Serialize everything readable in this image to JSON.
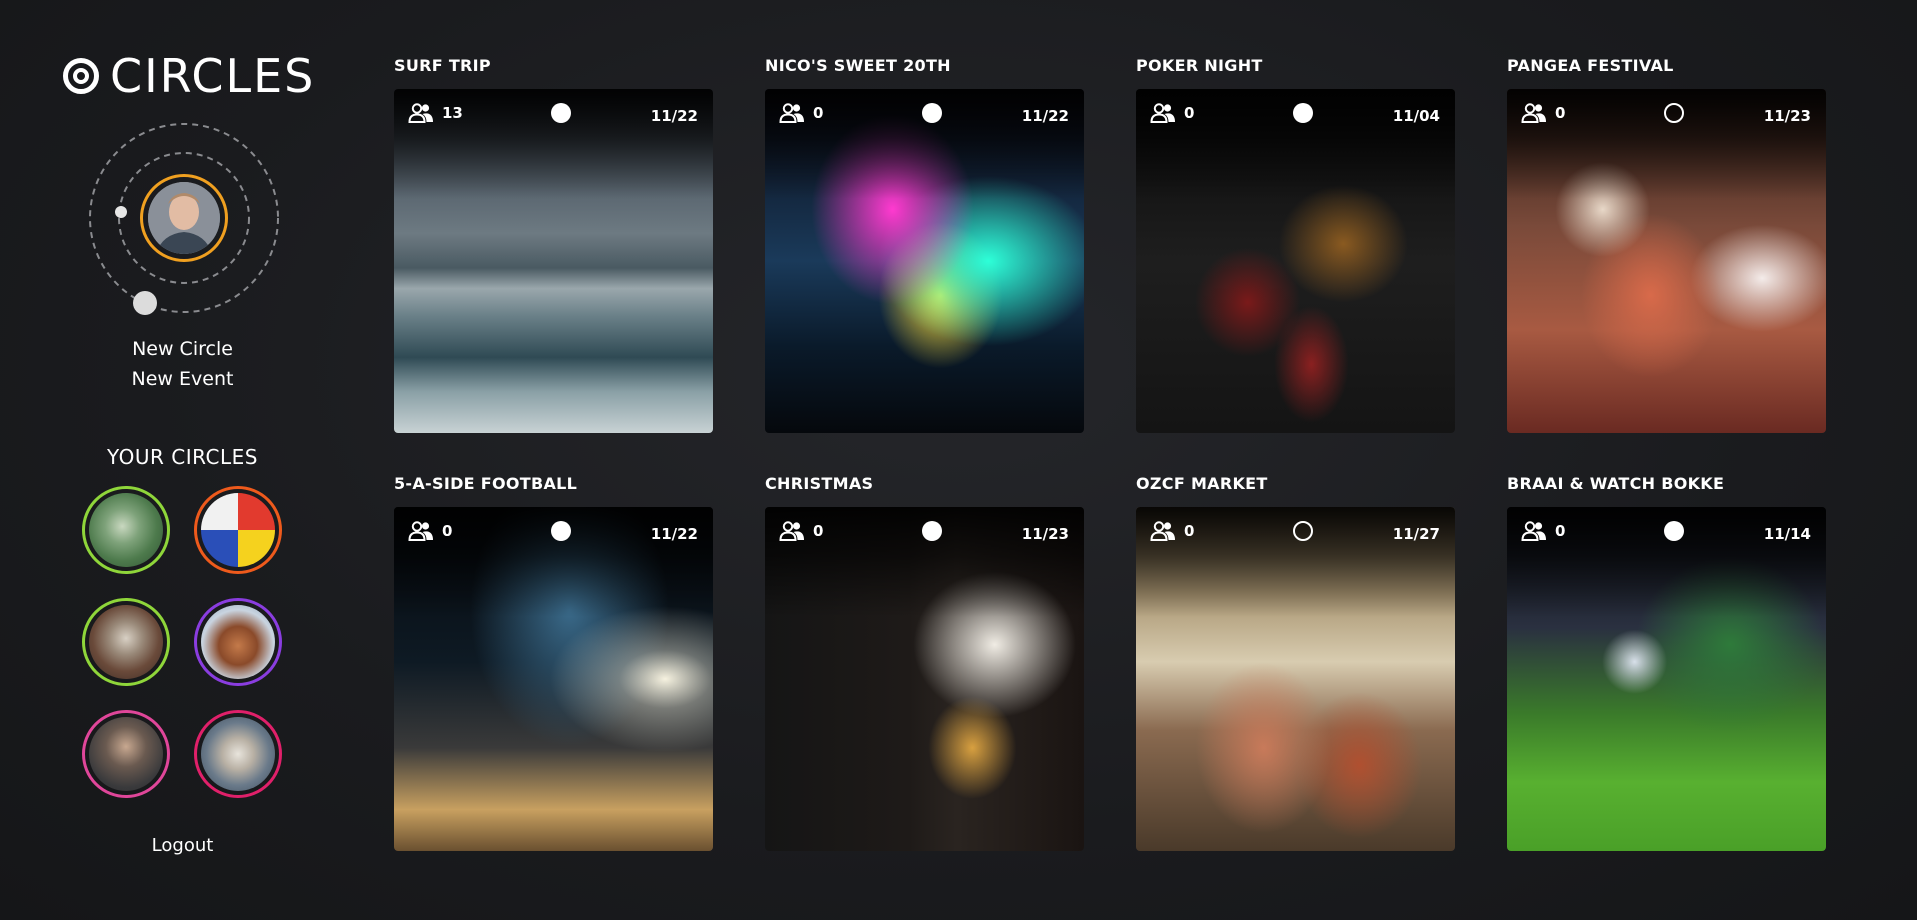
{
  "app": {
    "name": "CIRCLES"
  },
  "sidebar": {
    "new_circle": "New Circle",
    "new_event": "New Event",
    "your_circles_title": "YOUR CIRCLES",
    "logout": "Logout",
    "circles": [
      {
        "ring_color": "#8fd63a"
      },
      {
        "ring_color": "#ee5a1c"
      },
      {
        "ring_color": "#8fd63a"
      },
      {
        "ring_color": "#8a3de0"
      },
      {
        "ring_color": "#e0469a"
      },
      {
        "ring_color": "#e0206a"
      }
    ]
  },
  "events": [
    {
      "title": "SURF TRIP",
      "members": "13",
      "date": "11/22",
      "status": "filled"
    },
    {
      "title": "NICO'S SWEET 20TH",
      "members": "0",
      "date": "11/22",
      "status": "filled"
    },
    {
      "title": "POKER NIGHT",
      "members": "0",
      "date": "11/04",
      "status": "filled"
    },
    {
      "title": "PANGEA FESTIVAL",
      "members": "0",
      "date": "11/23",
      "status": "hollow"
    },
    {
      "title": "5-A-SIDE FOOTBALL",
      "members": "0",
      "date": "11/22",
      "status": "filled"
    },
    {
      "title": "CHRISTMAS",
      "members": "0",
      "date": "11/23",
      "status": "filled"
    },
    {
      "title": "OZCF MARKET",
      "members": "0",
      "date": "11/27",
      "status": "hollow"
    },
    {
      "title": "BRAAI & WATCH BOKKE",
      "members": "0",
      "date": "11/14",
      "status": "filled"
    }
  ],
  "colors": {
    "background": "#1b1c1f",
    "avatar_ring": "#f0a020",
    "text": "#ffffff"
  },
  "icons": {
    "logo": "target-icon",
    "members": "group-icon"
  }
}
